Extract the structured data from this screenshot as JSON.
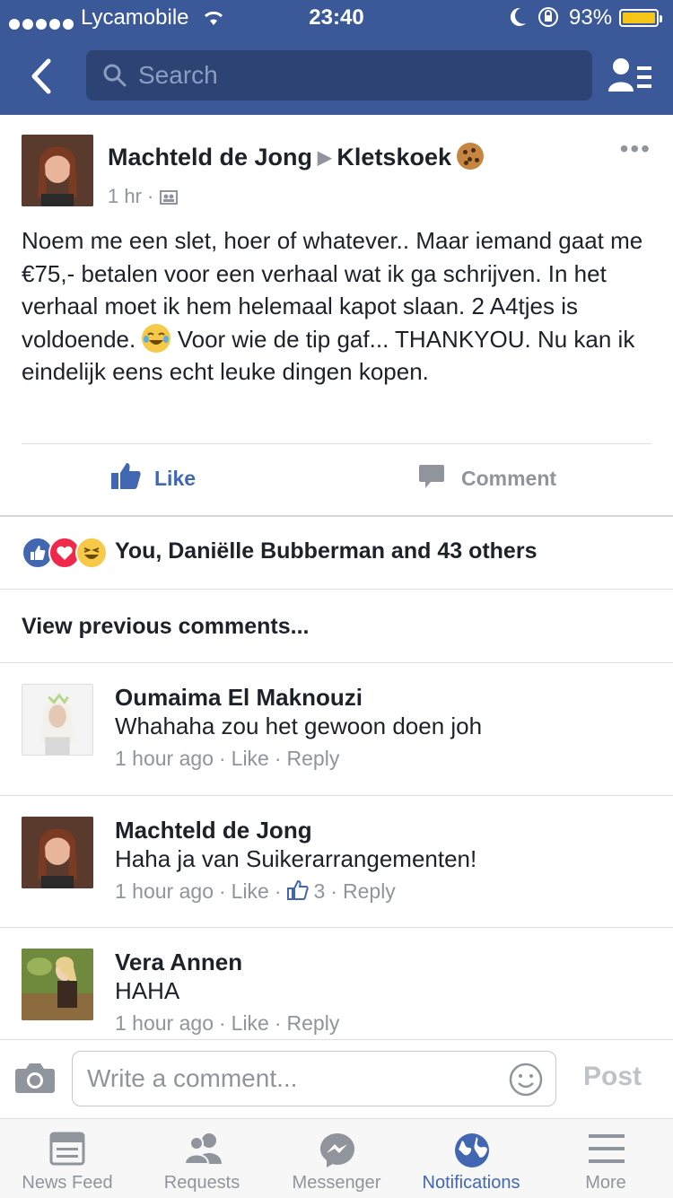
{
  "status_bar": {
    "carrier": "Lycamobile",
    "time": "23:40",
    "battery": "93%"
  },
  "nav": {
    "search_placeholder": "Search"
  },
  "post": {
    "author": "Machteld de Jong",
    "group": "Kletskoek",
    "time": "1 hr",
    "text_part1": "Noem me een slet, hoer of whatever.. Maar iemand gaat me €75,- betalen voor een verhaal wat ik ga schrijven. In het verhaal moet ik hem helemaal kapot slaan. 2 A4tjes is voldoende.",
    "text_part2": "Voor wie de tip gaf... THANKYOU. Nu kan ik eindelijk eens echt leuke dingen kopen.",
    "like_label": "Like",
    "comment_label": "Comment"
  },
  "reactions": {
    "summary": "You, Daniëlle Bubberman and 43 others"
  },
  "view_previous": "View previous comments...",
  "comments": [
    {
      "name": "Oumaima El Maknouzi",
      "text": "Whahaha zou het gewoon doen joh",
      "time": "1 hour ago",
      "like": "Like",
      "reply": "Reply"
    },
    {
      "name": "Machteld de Jong",
      "text": "Haha ja van Suikerarrangementen!",
      "time": "1 hour ago",
      "like": "Like",
      "like_count": "3",
      "reply": "Reply"
    },
    {
      "name": "Vera Annen",
      "text": "HAHA",
      "time": "1 hour ago",
      "like": "Like",
      "reply": "Reply"
    }
  ],
  "composer": {
    "placeholder": "Write a comment...",
    "post_label": "Post"
  },
  "tabs": [
    {
      "label": "News Feed",
      "icon": "news-feed-icon"
    },
    {
      "label": "Requests",
      "icon": "requests-icon"
    },
    {
      "label": "Messenger",
      "icon": "messenger-icon"
    },
    {
      "label": "Notifications",
      "icon": "globe-icon",
      "active": true
    },
    {
      "label": "More",
      "icon": "menu-icon"
    }
  ],
  "colors": {
    "brand": "#3b5998",
    "link_blue": "#4267b2",
    "muted": "#90949c"
  }
}
